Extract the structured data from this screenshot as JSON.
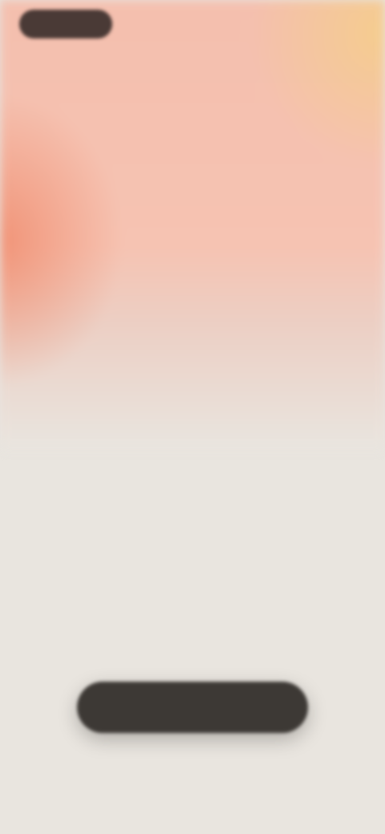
{
  "header": {
    "logo_label": "",
    "top_link_label": ""
  },
  "hero": {
    "title": "",
    "subtitle": ""
  },
  "cta": {
    "label": ""
  },
  "colors": {
    "background": "#e9e5df",
    "hero_coral": "#f08c6e",
    "hero_peach": "#f6c3b2",
    "hero_gold": "#f5cd8c",
    "button": "#3d3935",
    "logo": "#4a3a36"
  }
}
